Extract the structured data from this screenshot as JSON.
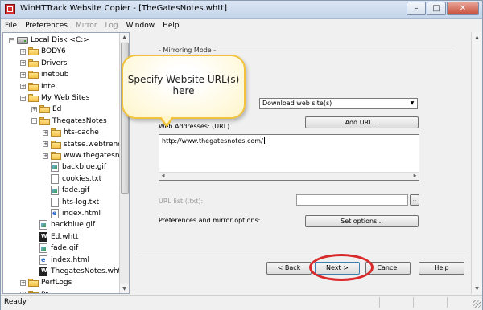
{
  "window": {
    "title": "WinHTTrack Website Copier - [TheGatesNotes.whtt]"
  },
  "menu": [
    {
      "label": "File",
      "disabled": false
    },
    {
      "label": "Preferences",
      "disabled": false
    },
    {
      "label": "Mirror",
      "disabled": true
    },
    {
      "label": "Log",
      "disabled": true
    },
    {
      "label": "Window",
      "disabled": false
    },
    {
      "label": "Help",
      "disabled": false
    }
  ],
  "tree": [
    {
      "label": "Local Disk <C:>",
      "type": "drive",
      "depth": 0,
      "expander": "-"
    },
    {
      "label": "BODY6",
      "type": "folder",
      "depth": 1,
      "expander": "+"
    },
    {
      "label": "Drivers",
      "type": "folder",
      "depth": 1,
      "expander": "+"
    },
    {
      "label": "inetpub",
      "type": "folder",
      "depth": 1,
      "expander": "+"
    },
    {
      "label": "Intel",
      "type": "folder",
      "depth": 1,
      "expander": "+"
    },
    {
      "label": "My Web Sites",
      "type": "folder",
      "depth": 1,
      "expander": "-"
    },
    {
      "label": "Ed",
      "type": "folder",
      "depth": 2,
      "expander": "+"
    },
    {
      "label": "ThegatesNotes",
      "type": "folder",
      "depth": 2,
      "expander": "-"
    },
    {
      "label": "hts-cache",
      "type": "folder",
      "depth": 3,
      "expander": "+"
    },
    {
      "label": "statse.webtrends",
      "type": "folder",
      "depth": 3,
      "expander": "+"
    },
    {
      "label": "www.thegatesno",
      "type": "folder",
      "depth": 3,
      "expander": "+"
    },
    {
      "label": "backblue.gif",
      "type": "img",
      "depth": 3,
      "expander": ""
    },
    {
      "label": "cookies.txt",
      "type": "txt",
      "depth": 3,
      "expander": ""
    },
    {
      "label": "fade.gif",
      "type": "img",
      "depth": 3,
      "expander": ""
    },
    {
      "label": "hts-log.txt",
      "type": "txt",
      "depth": 3,
      "expander": ""
    },
    {
      "label": "index.html",
      "type": "html",
      "depth": 3,
      "expander": ""
    },
    {
      "label": "backblue.gif",
      "type": "img",
      "depth": 2,
      "expander": ""
    },
    {
      "label": "Ed.whtt",
      "type": "whtt",
      "depth": 2,
      "expander": ""
    },
    {
      "label": "fade.gif",
      "type": "img",
      "depth": 2,
      "expander": ""
    },
    {
      "label": "index.html",
      "type": "html",
      "depth": 2,
      "expander": ""
    },
    {
      "label": "ThegatesNotes.whtt",
      "type": "whtt",
      "depth": 2,
      "expander": ""
    },
    {
      "label": "PerfLogs",
      "type": "folder",
      "depth": 1,
      "expander": "+"
    },
    {
      "label": "Pr...",
      "type": "folder",
      "depth": 1,
      "expander": "+"
    }
  ],
  "panel": {
    "section_title": "- Mirroring Mode -",
    "action_value": "Download web site(s)",
    "web_addresses_label": "Web Addresses: (URL)",
    "add_url_label": "Add URL...",
    "url_text": "http://www.thegatesnotes.com/",
    "url_list_label": "URL list (.txt):",
    "browse_label": "..",
    "prefs_label": "Preferences and mirror options:",
    "set_options_label": "Set options..."
  },
  "nav": {
    "back_label": "< Back",
    "next_label": "Next >",
    "cancel_label": "Cancel",
    "help_label": "Help"
  },
  "callout": {
    "line1": "Specify Website URL(s)",
    "line2": "here"
  },
  "status": {
    "text": "Ready"
  },
  "colors": {
    "callout_border": "#f2c23c",
    "highlight_ring": "#d92b2b"
  }
}
